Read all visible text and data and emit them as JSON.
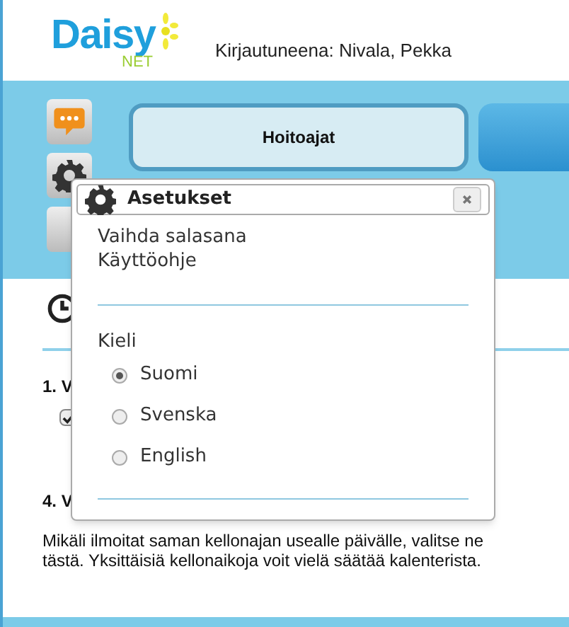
{
  "header": {
    "logo": {
      "word": "Daisy",
      "sub": "NET"
    },
    "logged_in": "Kirjautuneena: Nivala, Pekka"
  },
  "tabs": [
    {
      "label": "Hoitoajat",
      "selected": true
    },
    {
      "selected": false
    }
  ],
  "content": {
    "section_1": "1. V",
    "checkbox": {
      "checked": true
    },
    "section_4": "4. V",
    "help": "Mikäli ilmoitat saman kellonajan usealle päivälle, valitse ne tästä. Yksittäisiä kellonaikoja voit vielä säätää kalenterista."
  },
  "dialog": {
    "title": "Asetukset",
    "links": [
      "Vaihda salasana",
      "Käyttöohje"
    ],
    "language_label": "Kieli",
    "languages": [
      {
        "label": "Suomi",
        "selected": true
      },
      {
        "label": "Svenska",
        "selected": false
      },
      {
        "label": "English",
        "selected": false
      }
    ]
  }
}
